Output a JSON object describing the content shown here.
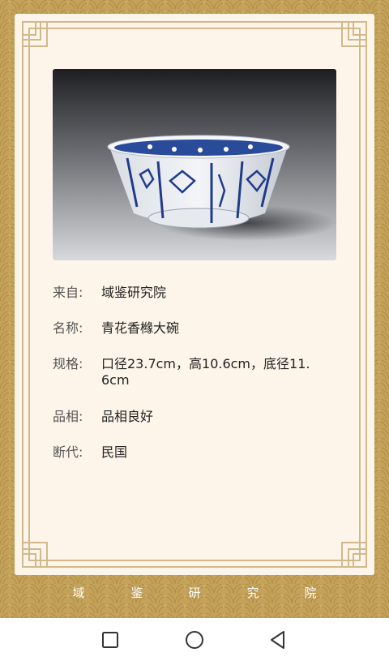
{
  "details": {
    "rows": [
      {
        "label": "来自:",
        "value": "域鉴研究院"
      },
      {
        "label": "名称:",
        "value": "青花香橼大碗"
      },
      {
        "label": "规格:",
        "value": "口径23.7cm，高10.6cm，底径11.6cm"
      },
      {
        "label": "品相:",
        "value": "品相良好"
      },
      {
        "label": "断代:",
        "value": "民国"
      }
    ]
  },
  "footer": {
    "chars": [
      "域",
      "鉴",
      "研",
      "究",
      "院"
    ]
  },
  "colors": {
    "background": "#c4a25a",
    "card": "#fdf5ea",
    "frame": "#d2b98c"
  },
  "navbar": {
    "icons": [
      "square-recent-apps-icon",
      "circle-home-icon",
      "triangle-back-icon"
    ]
  }
}
